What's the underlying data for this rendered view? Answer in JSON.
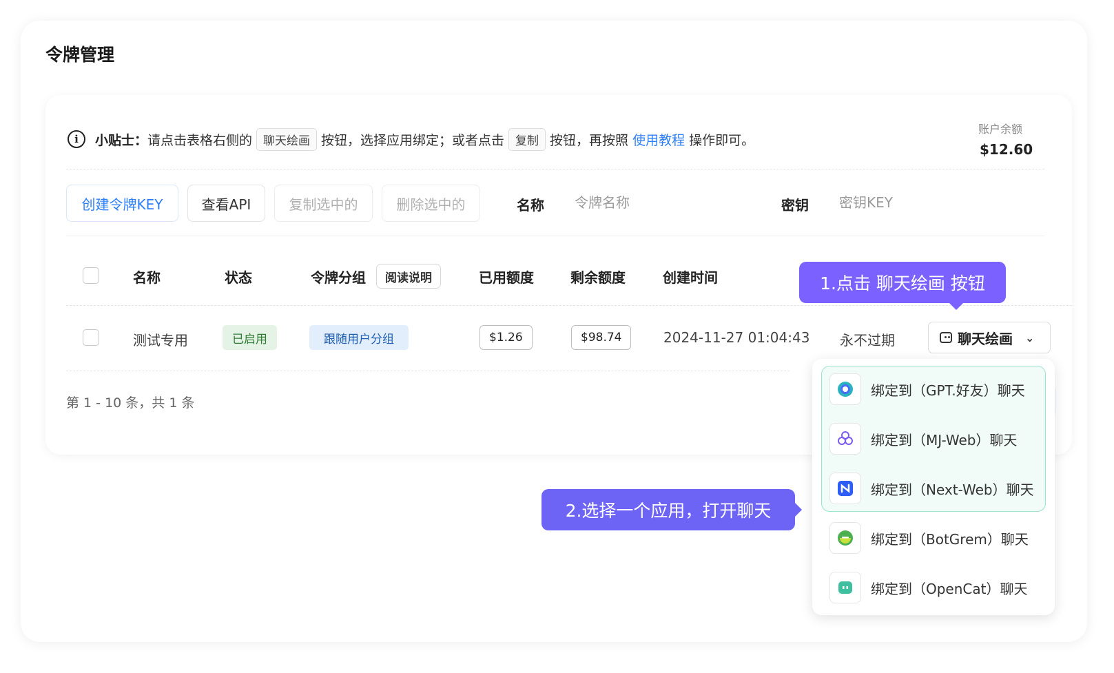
{
  "page": {
    "title": "令牌管理"
  },
  "tip": {
    "prefix": "小贴士：",
    "text1": "请点击表格右侧的",
    "kbd1": "聊天绘画",
    "text2": "按钮，选择应用绑定；或者点击",
    "kbd2": "复制",
    "text3": "按钮，再按照",
    "link": "使用教程",
    "text4": "操作即可。"
  },
  "balance": {
    "label": "账户余额",
    "value": "$12.60"
  },
  "toolbar": {
    "create": "创建令牌KEY",
    "view_api": "查看API",
    "copy_selected": "复制选中的",
    "delete_selected": "删除选中的",
    "name_label": "名称",
    "name_placeholder": "令牌名称",
    "key_label": "密钥",
    "key_placeholder": "密钥KEY"
  },
  "table": {
    "headers": {
      "name": "名称",
      "status": "状态",
      "group": "令牌分组",
      "read_doc": "阅读说明",
      "used": "已用额度",
      "remaining": "剩余额度",
      "created": "创建时间"
    },
    "rows": [
      {
        "name": "测试专用",
        "status": "已启用",
        "group": "跟随用户分组",
        "used": "$1.26",
        "remaining": "$98.74",
        "created": "2024-11-27 01:04:43",
        "expire": "永不过期",
        "action": "聊天绘画"
      }
    ]
  },
  "pagination": {
    "text": "第 1 - 10 条，共 1 条"
  },
  "callouts": {
    "step1": "1.点击 聊天绘画 按钮",
    "step2": "2.选择一个应用，打开聊天"
  },
  "dropdown": {
    "items": [
      {
        "label": "绑定到（GPT.好友）聊天",
        "icon": "gpt-friend-icon"
      },
      {
        "label": "绑定到（MJ-Web）聊天",
        "icon": "mj-web-icon"
      },
      {
        "label": "绑定到（Next-Web）聊天",
        "icon": "next-web-icon"
      },
      {
        "label": "绑定到（BotGrem）聊天",
        "icon": "botgrem-icon"
      },
      {
        "label": "绑定到（OpenCat）聊天",
        "icon": "opencat-icon"
      }
    ]
  },
  "colors": {
    "accent_blue": "#2d7ff9",
    "callout_purple": "#7b61ff",
    "status_green": "#2e7d32",
    "dropdown_highlight": "#9be3cf"
  }
}
